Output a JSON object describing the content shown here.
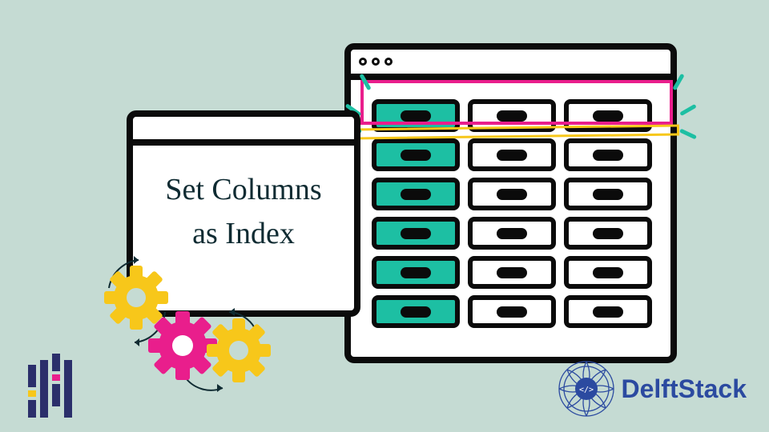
{
  "title_line1": "Set Columns",
  "title_line2": "as Index",
  "brand": "DelftStack",
  "colors": {
    "bg": "#c5dbd3",
    "teal": "#1dbfa3",
    "magenta": "#e91e8c",
    "yellow": "#f7c71a",
    "ink": "#0b0b0b",
    "brand_blue": "#2b4aa0"
  },
  "icons": {
    "front_window": "dialog-window",
    "back_window": "data-table-window",
    "gear_yellow_1": "gear-icon",
    "gear_magenta": "gear-icon",
    "gear_yellow_2": "gear-icon",
    "pandas": "pandas-logo",
    "mandala": "delftstack-mandala"
  },
  "table": {
    "rows": 6,
    "cols": 3,
    "index_col": 0
  }
}
